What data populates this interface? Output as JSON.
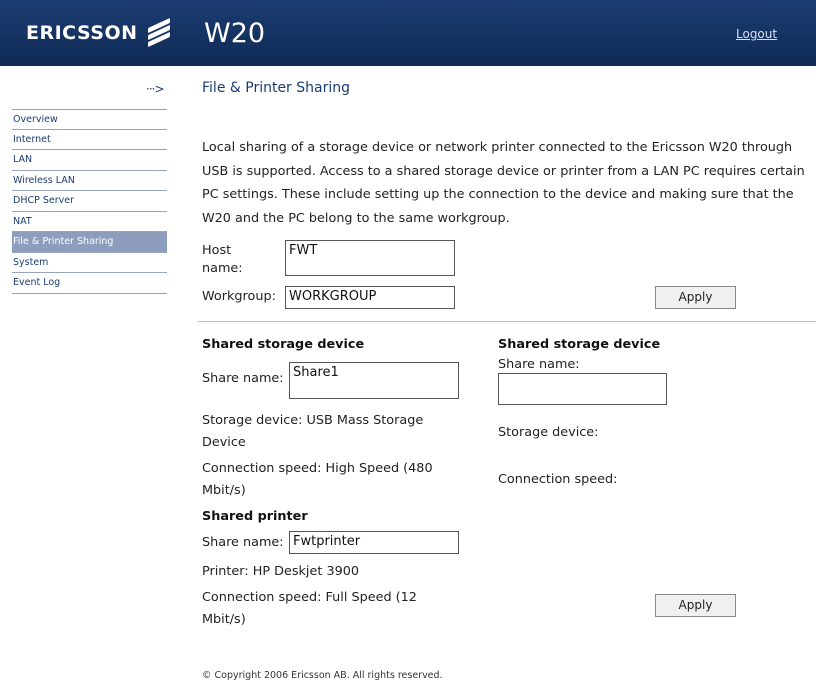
{
  "header": {
    "brand": "ERICSSON",
    "title": "W20",
    "logout": "Logout"
  },
  "sidebar": {
    "arrow": "···>",
    "items": [
      {
        "label": "Overview"
      },
      {
        "label": "Internet"
      },
      {
        "label": "LAN"
      },
      {
        "label": "Wireless LAN"
      },
      {
        "label": "DHCP Server"
      },
      {
        "label": "NAT"
      },
      {
        "label": "File & Printer Sharing",
        "active": true
      },
      {
        "label": "System"
      },
      {
        "label": "Event Log"
      }
    ]
  },
  "main": {
    "title": "File & Printer Sharing",
    "description": "Local sharing of a storage device or network printer connected to the Ericsson W20 through USB is supported. Access to a shared storage device or printer from a LAN PC requires certain PC settings. These include setting up the connection to the device and making sure that the W20 and the PC belong to the same workgroup.",
    "host_label_1": "Host",
    "host_label_2": "name:",
    "host_value": "FWT",
    "workgroup_label": "Workgroup:",
    "workgroup_value": "WORKGROUP",
    "apply_label": "Apply"
  },
  "storage_left": {
    "heading": "Shared storage device",
    "share_label": "Share name:",
    "share_value": "Share1",
    "device_line1": "Storage device:  USB Mass Storage",
    "device_line2": "Device",
    "speed_line1": "Connection speed:  High Speed (480",
    "speed_line2": "Mbit/s)"
  },
  "storage_right": {
    "heading": "Shared storage device",
    "share_label": "Share name:",
    "share_value": "",
    "device_label": "Storage device:",
    "speed_label": "Connection speed:"
  },
  "printer": {
    "heading": "Shared printer",
    "share_label": "Share name:",
    "share_value": "Fwtprinter",
    "printer_line": "Printer:  HP Deskjet 3900",
    "speed_line1": "Connection speed:  Full Speed (12",
    "speed_line2": "Mbit/s)",
    "apply_label": "Apply"
  },
  "footer": {
    "copyright": "© Copyright 2006 Ericsson AB. All rights reserved."
  },
  "colors": {
    "header_bg": "#1c3d72",
    "active_nav_bg": "#8c9dbe",
    "nav_text": "#1c3d72"
  }
}
